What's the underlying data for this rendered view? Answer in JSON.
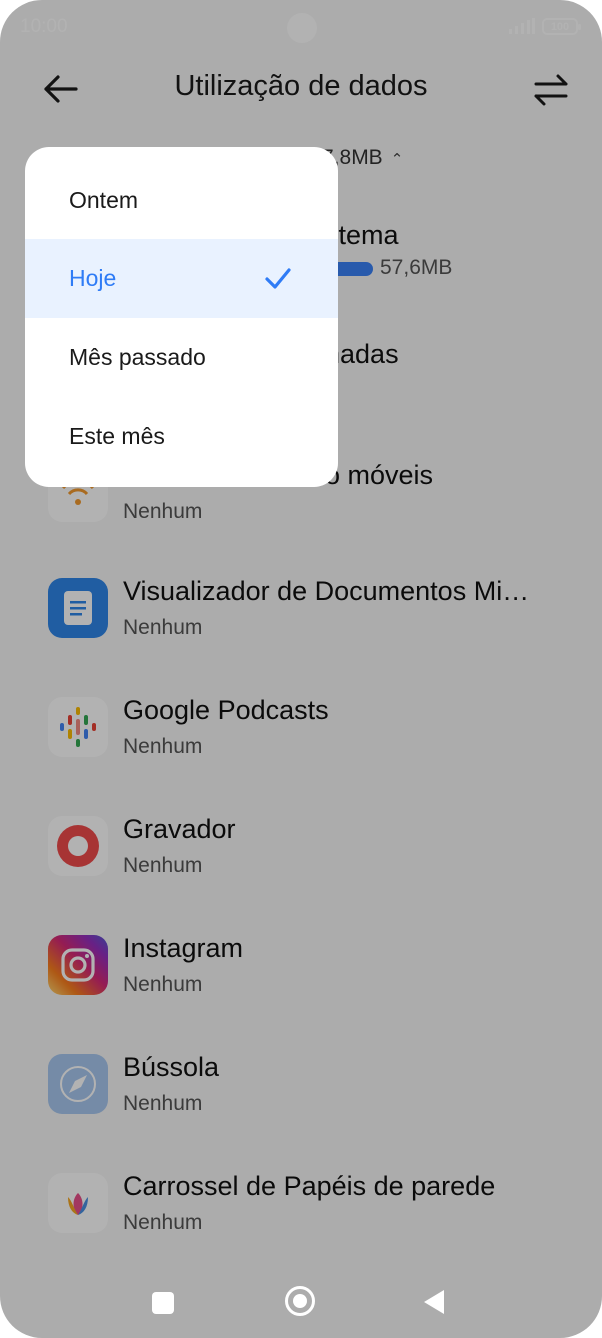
{
  "status_bar": {
    "time": "10:00",
    "battery": "100"
  },
  "header": {
    "title": "Utilização de dados"
  },
  "summary": {
    "total_usage_partial": "7,8MB"
  },
  "apps": [
    {
      "name": "stema",
      "usage": "57,6MB",
      "usage_fraction": 1.0
    },
    {
      "name": "nadas",
      "usage": ""
    },
    {
      "name": "o móveis",
      "usage": "Nenhum"
    },
    {
      "name": "Visualizador de Documentos Mi…",
      "usage": "Nenhum"
    },
    {
      "name": "Google Podcasts",
      "usage": "Nenhum"
    },
    {
      "name": "Gravador",
      "usage": "Nenhum"
    },
    {
      "name": "Instagram",
      "usage": "Nenhum"
    },
    {
      "name": "Bússola",
      "usage": "Nenhum"
    },
    {
      "name": "Carrossel de Papéis de parede",
      "usage": "Nenhum"
    }
  ],
  "dropdown": {
    "options": [
      "Ontem",
      "Hoje",
      "Mês passado",
      "Este mês"
    ],
    "selected": "Hoje"
  },
  "colors": {
    "accent": "#2f7cf6",
    "selected_bg": "#e9f2ff"
  }
}
